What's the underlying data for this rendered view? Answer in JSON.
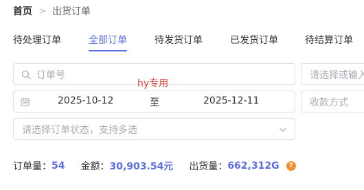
{
  "breadcrumb": {
    "home": "首页",
    "separator": ">",
    "current": "出货订单"
  },
  "tabs": [
    {
      "label": "待处理订单",
      "active": false
    },
    {
      "label": "全部订单",
      "active": true
    },
    {
      "label": "待发货订单",
      "active": false
    },
    {
      "label": "已发货订单",
      "active": false
    },
    {
      "label": "待结算订单",
      "active": false
    }
  ],
  "filters": {
    "order_no_placeholder": "订单号",
    "right_top_placeholder": "请选择或输入",
    "date_start": "2025-10-12",
    "date_to": "至",
    "date_end": "2025-12-11",
    "payment_placeholder": "收款方式",
    "status_placeholder": "请选择订单状态，支持多选"
  },
  "watermark": "hy专用",
  "summary": {
    "order_count_label": "订单量：",
    "order_count": "54",
    "amount_label": "金额：",
    "amount": "30,903.54元",
    "shipped_label": "出货量：",
    "shipped": "662,312G",
    "help_symbol": "?"
  },
  "colors": {
    "accent": "#5b6cde",
    "help": "#f0902e",
    "watermark": "#e1403b"
  },
  "icons": [
    "search-icon",
    "calendar-icon",
    "chevron-down-icon",
    "question-icon"
  ]
}
